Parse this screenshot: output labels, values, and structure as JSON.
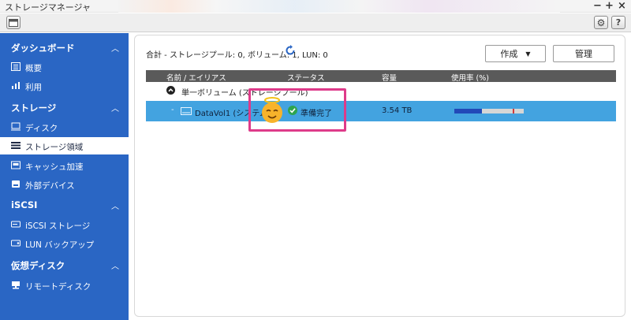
{
  "window": {
    "title": "ストレージマネージャ",
    "controls": [
      "−",
      "+",
      "×"
    ]
  },
  "sidebar": {
    "sections": [
      {
        "label": "ダッシュボード",
        "items": [
          {
            "label": "概要",
            "icon": "overview-icon"
          },
          {
            "label": "利用",
            "icon": "usage-chart-icon"
          }
        ]
      },
      {
        "label": "ストレージ",
        "items": [
          {
            "label": "ディスク",
            "icon": "disk-icon"
          },
          {
            "label": "ストレージ領域",
            "icon": "storage-space-icon",
            "active": true
          },
          {
            "label": "キャッシュ加速",
            "icon": "cache-icon"
          },
          {
            "label": "外部デバイス",
            "icon": "external-device-icon"
          }
        ]
      },
      {
        "label": "iSCSI",
        "items": [
          {
            "label": "iSCSI ストレージ",
            "icon": "iscsi-storage-icon"
          },
          {
            "label": "LUN バックアップ",
            "icon": "lun-backup-icon"
          }
        ]
      },
      {
        "label": "仮想ディスク",
        "items": [
          {
            "label": "リモートディスク",
            "icon": "remote-disk-icon"
          }
        ]
      }
    ]
  },
  "main": {
    "summary": "合計 - ストレージプール: 0, ボリューム: 1, LUN: 0",
    "buttons": {
      "create": "作成",
      "manage": "管理"
    },
    "columns": {
      "name": "名前 / エイリアス",
      "status": "ステータス",
      "capacity": "容量",
      "usage": "使用率 (%)"
    },
    "group": {
      "label": "単一ボリューム (ストレージプール)"
    },
    "volume": {
      "name": "DataVol1 (システム)",
      "status": "準備完了",
      "capacity": "3.54 TB",
      "usage_fraction": 0.4
    }
  }
}
